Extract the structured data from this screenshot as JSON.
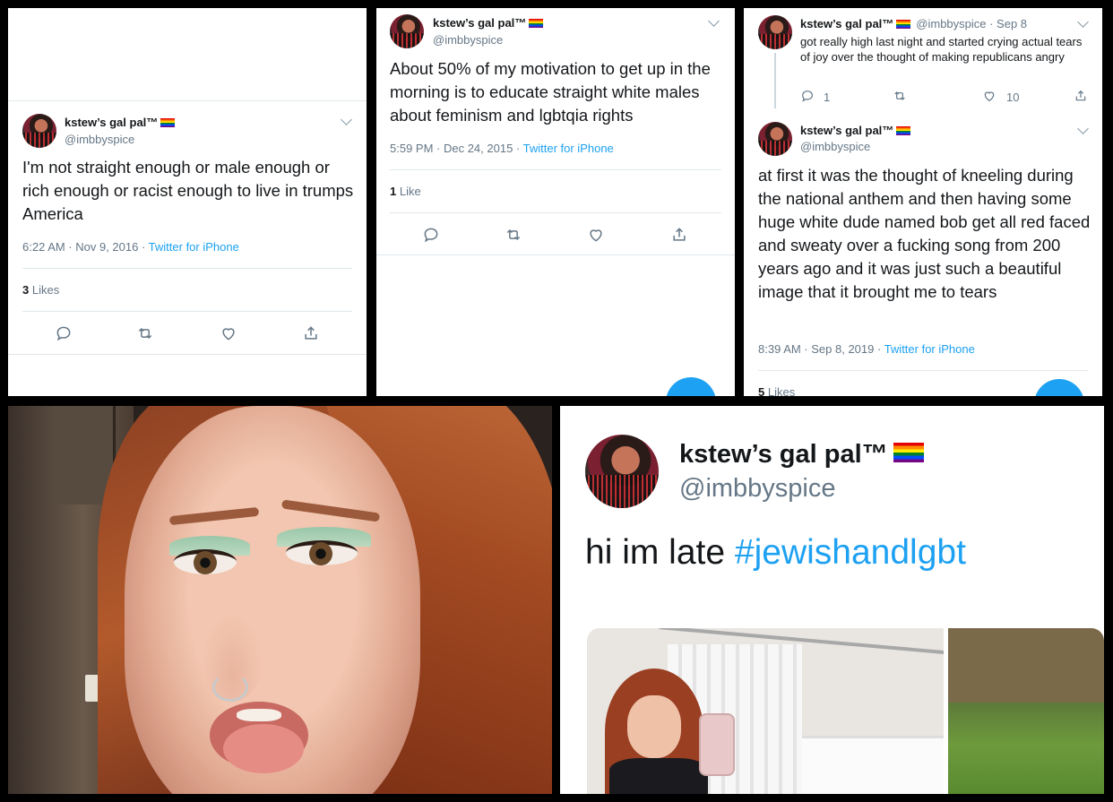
{
  "colors": {
    "link": "#1da1f2",
    "muted": "#657786",
    "text": "#14171a",
    "divider": "#e1e8ed"
  },
  "tweet1": {
    "name": "kstew’s gal pal™",
    "handle": "@imbbyspice",
    "text": "I'm not straight enough or male enough or rich enough or racist enough to live in trumps America",
    "time": "6:22 AM · Nov 9, 2016 · ",
    "source": "Twitter for iPhone",
    "likes_count": "3",
    "likes_label": " Likes"
  },
  "tweet2": {
    "name": "kstew’s gal pal™",
    "handle": "@imbbyspice",
    "text": "About 50% of my motivation to get up in the morning is to educate straight white males about feminism and lgbtqia rights",
    "time": "5:59 PM · Dec 24, 2015 · ",
    "source": "Twitter for iPhone",
    "likes_count": "1",
    "likes_label": " Like"
  },
  "tweet3": {
    "reply": {
      "name": "kstew’s gal pal™",
      "handle": "@imbbyspice · Sep 8",
      "text": "got really high last night and started crying actual tears of joy over the thought of making republicans angry",
      "reply_count": "1",
      "like_count": "10"
    },
    "main": {
      "name": "kstew’s gal pal™",
      "handle": "@imbbyspice",
      "text": "at first it was the thought of kneeling during the national anthem and then having some huge white dude named bob get all red faced and sweaty over a fucking song from 200 years ago and it was just such a beautiful image that it brought me to tears",
      "time": "8:39 AM · Sep 8, 2019 · ",
      "source": "Twitter for iPhone",
      "likes_count": "5",
      "likes_label": " Likes"
    }
  },
  "tweet5": {
    "name": "kstew’s gal pal™",
    "handle": "@imbbyspice",
    "text": "hi im late ",
    "hashtag": "#jewishandlgbt"
  },
  "icons": [
    "reply-icon",
    "retweet-icon",
    "like-icon",
    "share-icon",
    "chevron-down-icon"
  ]
}
